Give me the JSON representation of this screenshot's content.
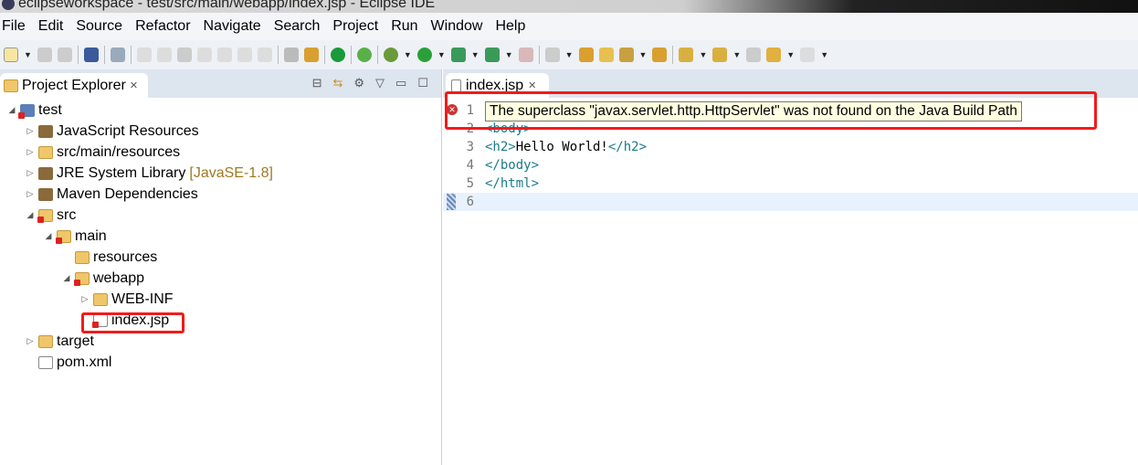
{
  "window": {
    "title": "eclipseworkspace - test/src/main/webapp/index.jsp - Eclipse IDE"
  },
  "menu": [
    "File",
    "Edit",
    "Source",
    "Refactor",
    "Navigate",
    "Search",
    "Project",
    "Run",
    "Window",
    "Help"
  ],
  "project_explorer": {
    "tab_label": "Project Explorer",
    "tree": [
      {
        "label": "test",
        "level": 0,
        "expanded": true,
        "icon": "project-icon",
        "error": true
      },
      {
        "label": "JavaScript Resources",
        "level": 1,
        "expanded": false,
        "icon": "library-icon"
      },
      {
        "label": "src/main/resources",
        "level": 1,
        "expanded": false,
        "icon": "package-folder-icon"
      },
      {
        "label": "JRE System Library",
        "decoration": "[JavaSE-1.8]",
        "level": 1,
        "expanded": false,
        "icon": "library-icon"
      },
      {
        "label": "Maven Dependencies",
        "level": 1,
        "expanded": false,
        "icon": "library-icon"
      },
      {
        "label": "src",
        "level": 1,
        "expanded": true,
        "icon": "folder-icon",
        "error": true
      },
      {
        "label": "main",
        "level": 2,
        "expanded": true,
        "icon": "folder-icon",
        "error": true
      },
      {
        "label": "resources",
        "level": 3,
        "icon": "folder-icon"
      },
      {
        "label": "webapp",
        "level": 3,
        "expanded": true,
        "icon": "folder-icon",
        "error": true
      },
      {
        "label": "WEB-INF",
        "level": 4,
        "expanded": false,
        "icon": "folder-icon"
      },
      {
        "label": "index.jsp",
        "level": 4,
        "icon": "jsp-file-icon",
        "error": true,
        "highlighted": true
      },
      {
        "label": "target",
        "level": 1,
        "expanded": false,
        "icon": "folder-icon"
      },
      {
        "label": "pom.xml",
        "level": 1,
        "icon": "maven-file-icon"
      }
    ]
  },
  "editor": {
    "tab_label": "index.jsp",
    "lines": [
      {
        "n": "1",
        "code": ""
      },
      {
        "n": "2",
        "code": "<body>"
      },
      {
        "n": "3",
        "code": "<h2>Hello World!</h2>"
      },
      {
        "n": "4",
        "code": "</body>"
      },
      {
        "n": "5",
        "code": "</html>"
      },
      {
        "n": "6",
        "code": ""
      }
    ],
    "error_tooltip": "The superclass \"javax.servlet.http.HttpServlet\" was not found on the Java Build Path"
  },
  "colors": {
    "highlight": "#f21b1b",
    "tooltip_bg": "#ffffe1"
  }
}
